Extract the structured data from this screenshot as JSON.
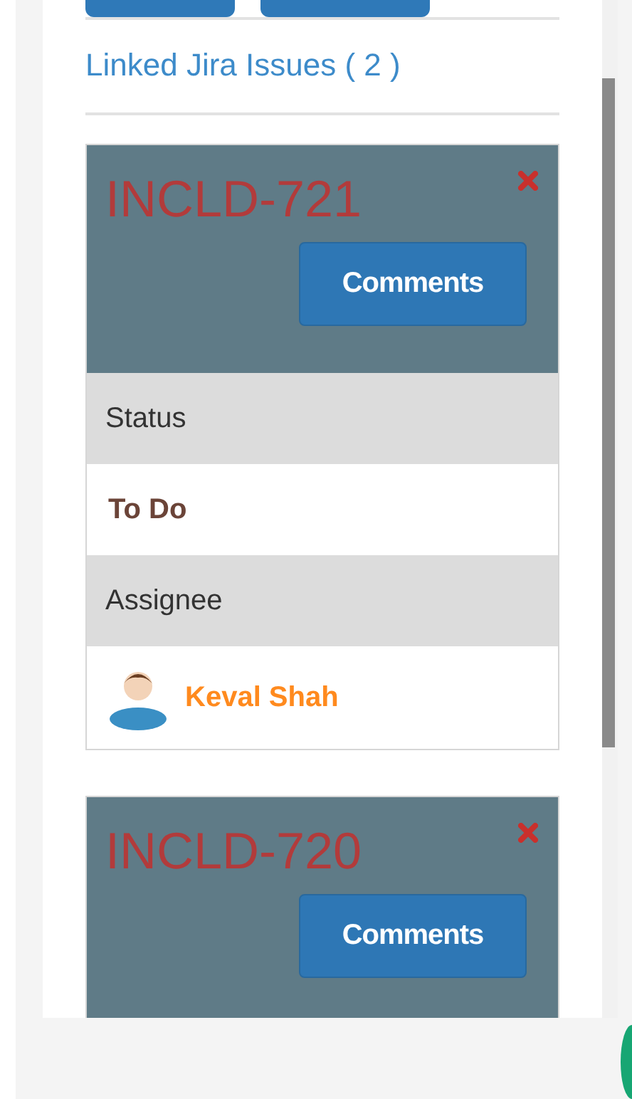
{
  "section_title": "Linked Jira Issues ( 2 )",
  "issues": [
    {
      "key": "INCLD-721",
      "comments_button": "Comments",
      "fields": [
        {
          "label": "Status",
          "value": "To Do",
          "kind": "status"
        },
        {
          "label": "Assignee",
          "value": "Keval Shah",
          "kind": "user"
        }
      ]
    },
    {
      "key": "INCLD-720",
      "comments_button": "Comments"
    }
  ]
}
